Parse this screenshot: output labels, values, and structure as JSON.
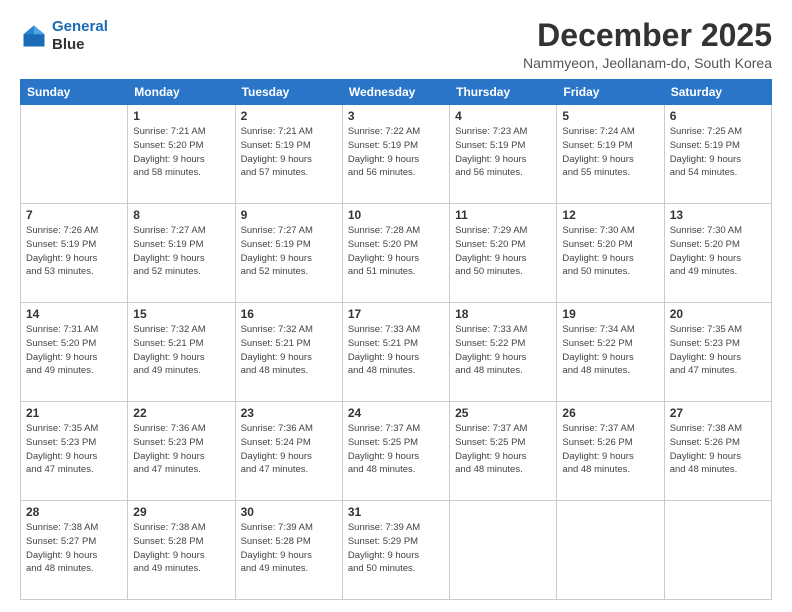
{
  "header": {
    "logo_line1": "General",
    "logo_line2": "Blue",
    "month": "December 2025",
    "location": "Nammyeon, Jeollanam-do, South Korea"
  },
  "weekdays": [
    "Sunday",
    "Monday",
    "Tuesday",
    "Wednesday",
    "Thursday",
    "Friday",
    "Saturday"
  ],
  "weeks": [
    [
      {
        "day": "",
        "info": ""
      },
      {
        "day": "1",
        "info": "Sunrise: 7:21 AM\nSunset: 5:20 PM\nDaylight: 9 hours\nand 58 minutes."
      },
      {
        "day": "2",
        "info": "Sunrise: 7:21 AM\nSunset: 5:19 PM\nDaylight: 9 hours\nand 57 minutes."
      },
      {
        "day": "3",
        "info": "Sunrise: 7:22 AM\nSunset: 5:19 PM\nDaylight: 9 hours\nand 56 minutes."
      },
      {
        "day": "4",
        "info": "Sunrise: 7:23 AM\nSunset: 5:19 PM\nDaylight: 9 hours\nand 56 minutes."
      },
      {
        "day": "5",
        "info": "Sunrise: 7:24 AM\nSunset: 5:19 PM\nDaylight: 9 hours\nand 55 minutes."
      },
      {
        "day": "6",
        "info": "Sunrise: 7:25 AM\nSunset: 5:19 PM\nDaylight: 9 hours\nand 54 minutes."
      }
    ],
    [
      {
        "day": "7",
        "info": "Sunrise: 7:26 AM\nSunset: 5:19 PM\nDaylight: 9 hours\nand 53 minutes."
      },
      {
        "day": "8",
        "info": "Sunrise: 7:27 AM\nSunset: 5:19 PM\nDaylight: 9 hours\nand 52 minutes."
      },
      {
        "day": "9",
        "info": "Sunrise: 7:27 AM\nSunset: 5:19 PM\nDaylight: 9 hours\nand 52 minutes."
      },
      {
        "day": "10",
        "info": "Sunrise: 7:28 AM\nSunset: 5:20 PM\nDaylight: 9 hours\nand 51 minutes."
      },
      {
        "day": "11",
        "info": "Sunrise: 7:29 AM\nSunset: 5:20 PM\nDaylight: 9 hours\nand 50 minutes."
      },
      {
        "day": "12",
        "info": "Sunrise: 7:30 AM\nSunset: 5:20 PM\nDaylight: 9 hours\nand 50 minutes."
      },
      {
        "day": "13",
        "info": "Sunrise: 7:30 AM\nSunset: 5:20 PM\nDaylight: 9 hours\nand 49 minutes."
      }
    ],
    [
      {
        "day": "14",
        "info": "Sunrise: 7:31 AM\nSunset: 5:20 PM\nDaylight: 9 hours\nand 49 minutes."
      },
      {
        "day": "15",
        "info": "Sunrise: 7:32 AM\nSunset: 5:21 PM\nDaylight: 9 hours\nand 49 minutes."
      },
      {
        "day": "16",
        "info": "Sunrise: 7:32 AM\nSunset: 5:21 PM\nDaylight: 9 hours\nand 48 minutes."
      },
      {
        "day": "17",
        "info": "Sunrise: 7:33 AM\nSunset: 5:21 PM\nDaylight: 9 hours\nand 48 minutes."
      },
      {
        "day": "18",
        "info": "Sunrise: 7:33 AM\nSunset: 5:22 PM\nDaylight: 9 hours\nand 48 minutes."
      },
      {
        "day": "19",
        "info": "Sunrise: 7:34 AM\nSunset: 5:22 PM\nDaylight: 9 hours\nand 48 minutes."
      },
      {
        "day": "20",
        "info": "Sunrise: 7:35 AM\nSunset: 5:23 PM\nDaylight: 9 hours\nand 47 minutes."
      }
    ],
    [
      {
        "day": "21",
        "info": "Sunrise: 7:35 AM\nSunset: 5:23 PM\nDaylight: 9 hours\nand 47 minutes."
      },
      {
        "day": "22",
        "info": "Sunrise: 7:36 AM\nSunset: 5:23 PM\nDaylight: 9 hours\nand 47 minutes."
      },
      {
        "day": "23",
        "info": "Sunrise: 7:36 AM\nSunset: 5:24 PM\nDaylight: 9 hours\nand 47 minutes."
      },
      {
        "day": "24",
        "info": "Sunrise: 7:37 AM\nSunset: 5:25 PM\nDaylight: 9 hours\nand 48 minutes."
      },
      {
        "day": "25",
        "info": "Sunrise: 7:37 AM\nSunset: 5:25 PM\nDaylight: 9 hours\nand 48 minutes."
      },
      {
        "day": "26",
        "info": "Sunrise: 7:37 AM\nSunset: 5:26 PM\nDaylight: 9 hours\nand 48 minutes."
      },
      {
        "day": "27",
        "info": "Sunrise: 7:38 AM\nSunset: 5:26 PM\nDaylight: 9 hours\nand 48 minutes."
      }
    ],
    [
      {
        "day": "28",
        "info": "Sunrise: 7:38 AM\nSunset: 5:27 PM\nDaylight: 9 hours\nand 48 minutes."
      },
      {
        "day": "29",
        "info": "Sunrise: 7:38 AM\nSunset: 5:28 PM\nDaylight: 9 hours\nand 49 minutes."
      },
      {
        "day": "30",
        "info": "Sunrise: 7:39 AM\nSunset: 5:28 PM\nDaylight: 9 hours\nand 49 minutes."
      },
      {
        "day": "31",
        "info": "Sunrise: 7:39 AM\nSunset: 5:29 PM\nDaylight: 9 hours\nand 50 minutes."
      },
      {
        "day": "",
        "info": ""
      },
      {
        "day": "",
        "info": ""
      },
      {
        "day": "",
        "info": ""
      }
    ]
  ]
}
